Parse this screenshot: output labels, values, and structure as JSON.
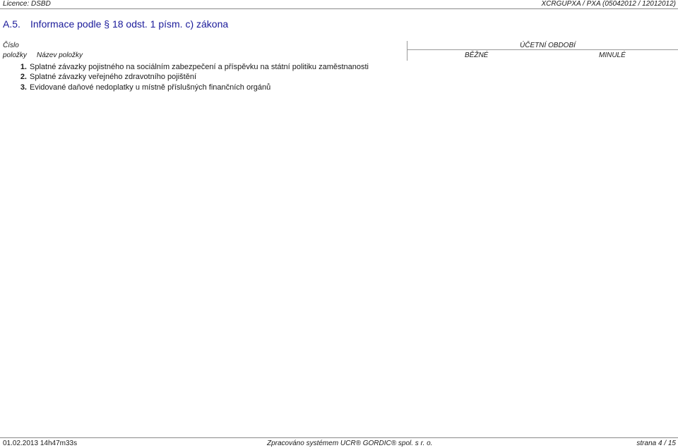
{
  "header": {
    "licence": "Licence: DSBD",
    "report_id": "XCRGUPXA / PXA  (05042012 / 12012012)"
  },
  "section": {
    "code": "A.5.",
    "title": "Informace podle § 18 odst. 1 písm. c) zákona"
  },
  "columns": {
    "cislo": "Číslo",
    "polozky": "položky",
    "nazev": "Název položky",
    "obdobi": "ÚČETNÍ OBDOBÍ",
    "bezne": "BĚŽNÉ",
    "minule": "MINULÉ"
  },
  "rows": [
    {
      "num": "1.",
      "text": "Splatné závazky pojistného na sociálním zabezpečení a příspěvku na státní politiku zaměstnanosti"
    },
    {
      "num": "2.",
      "text": "Splatné závazky veřejného zdravotního pojištění"
    },
    {
      "num": "3.",
      "text": "Evidované daňové nedoplatky u místně příslušných finančních orgánů"
    }
  ],
  "footer": {
    "timestamp": "01.02.2013 14h47m33s",
    "processed_by": "Zpracováno systémem  UCR® GORDIC® spol. s  r. o.",
    "page": "strana 4 / 15"
  }
}
